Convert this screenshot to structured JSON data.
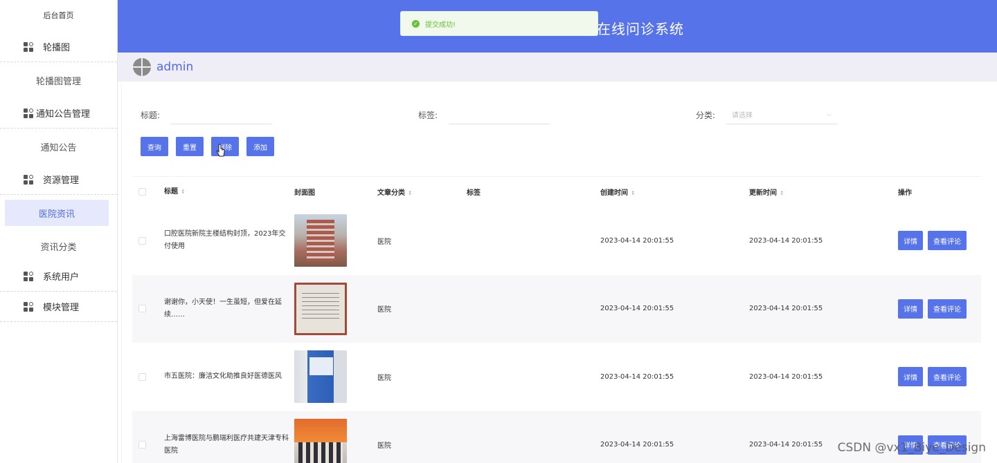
{
  "sidebar": {
    "home": "后台首页",
    "groups": [
      {
        "label": "轮播图",
        "subs": [
          "轮播图管理"
        ]
      },
      {
        "label": "通知公告管理",
        "subs": [
          "通知公告"
        ]
      },
      {
        "label": "资源管理",
        "subs": [
          "医院资讯",
          "资讯分类"
        ]
      },
      {
        "label": "系统用户",
        "subs": []
      },
      {
        "label": "模块管理",
        "subs": []
      }
    ]
  },
  "header": {
    "title": "在线问诊系统"
  },
  "toast": {
    "message": "提交成功!"
  },
  "user": {
    "name": "admin"
  },
  "filters": {
    "title_label": "标题:",
    "tag_label": "标签:",
    "category_label": "分类:",
    "category_placeholder": "请选择"
  },
  "buttons": {
    "query": "查询",
    "reset": "重置",
    "delete": "删除",
    "add": "添加"
  },
  "table": {
    "headers": [
      "标题",
      "封面图",
      "文章分类",
      "标签",
      "创建时间",
      "更新时间",
      "操作"
    ],
    "rows": [
      {
        "title": "口腔医院新院主楼结构封顶，2023年交付使用",
        "category": "医院",
        "tag": "",
        "created": "2023-04-14 20:01:55",
        "updated": "2023-04-14 20:01:55"
      },
      {
        "title": "谢谢你，小天使！一生虽短，但爱在延续……",
        "category": "医院",
        "tag": "",
        "created": "2023-04-14 20:01:55",
        "updated": "2023-04-14 20:01:55"
      },
      {
        "title": "市五医院：廉洁文化助推良好医德医风",
        "category": "医院",
        "tag": "",
        "created": "2023-04-14 20:01:55",
        "updated": "2023-04-14 20:01:55"
      },
      {
        "title": "上海雷博医院与鹏瑞利医疗共建天津专科医院",
        "category": "医院",
        "tag": "",
        "created": "2023-04-14 20:01:55",
        "updated": "2023-04-14 20:01:55"
      }
    ],
    "op_detail": "详情",
    "op_comments": "查看评论"
  },
  "watermark": "CSDN @vx1_Biye_Design",
  "colors": {
    "primary": "#5673ea",
    "success": "#67c23a",
    "active_bg": "#e6e8fb"
  }
}
